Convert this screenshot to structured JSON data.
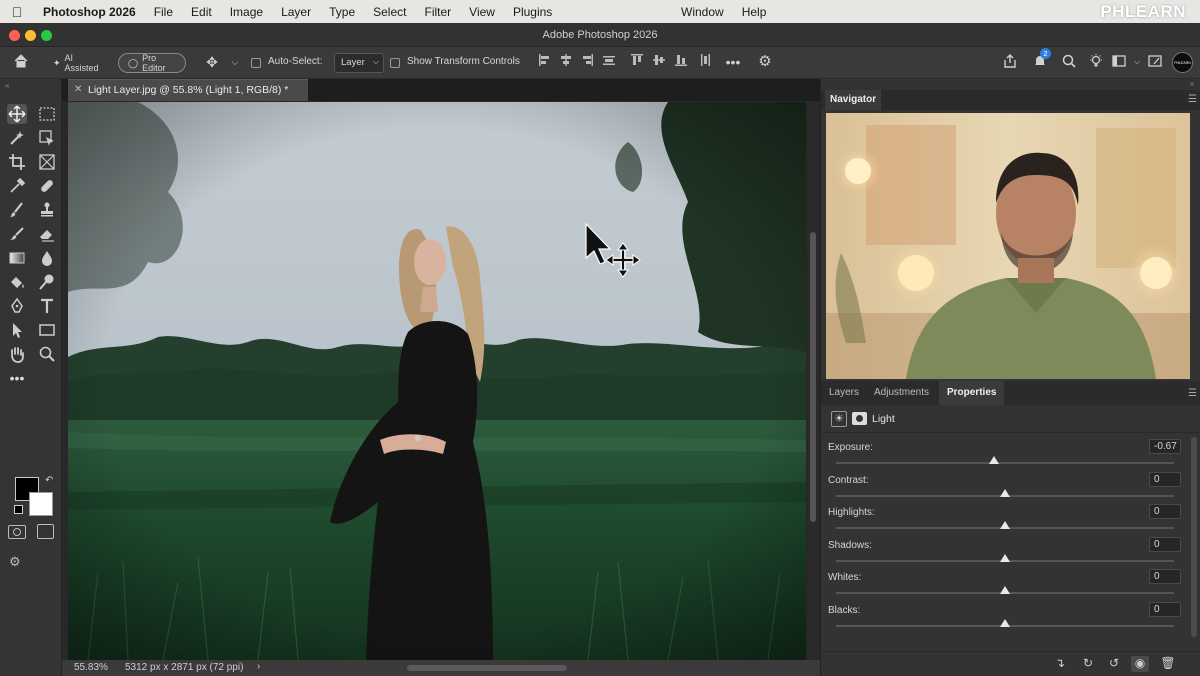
{
  "menubar": {
    "app_name": "Photoshop 2026",
    "items": [
      "File",
      "Edit",
      "Image",
      "Layer",
      "Type",
      "Select",
      "Filter",
      "View",
      "Plugins"
    ],
    "right_items": [
      "Window",
      "Help"
    ]
  },
  "watermark": "PHLEARN",
  "window": {
    "title": "Adobe Photoshop 2026"
  },
  "options_bar": {
    "ai_assisted": "AI Assisted",
    "pro_editor": "Pro Editor",
    "auto_select": "Auto-Select:",
    "auto_select_value": "Layer",
    "show_transform": "Show Transform Controls",
    "notification_count": "2",
    "avatar_text": "PHLEARN"
  },
  "document": {
    "tab_title": "Light Layer.jpg @ 55.8% (Light 1, RGB/8) *",
    "zoom": "55.83%",
    "dimensions": "5312 px x 2871 px (72 ppi)"
  },
  "navigator": {
    "title": "Navigator"
  },
  "panel": {
    "tabs": [
      "Layers",
      "Adjustments",
      "Properties"
    ],
    "active_tab": "Properties",
    "layer_name": "Light",
    "sliders": [
      {
        "label": "Exposure:",
        "value": "-0.67",
        "level": -0.067
      },
      {
        "label": "Contrast:",
        "value": "0",
        "level": 0
      },
      {
        "label": "Highlights:",
        "value": "0",
        "level": 0
      },
      {
        "label": "Shadows:",
        "value": "0",
        "level": 0
      },
      {
        "label": "Whites:",
        "value": "0",
        "level": 0
      },
      {
        "label": "Blacks:",
        "value": "0",
        "level": 0
      }
    ]
  },
  "colors": {
    "foreground": "#000000",
    "background": "#ffffff",
    "badge": "#2f7ddc"
  }
}
